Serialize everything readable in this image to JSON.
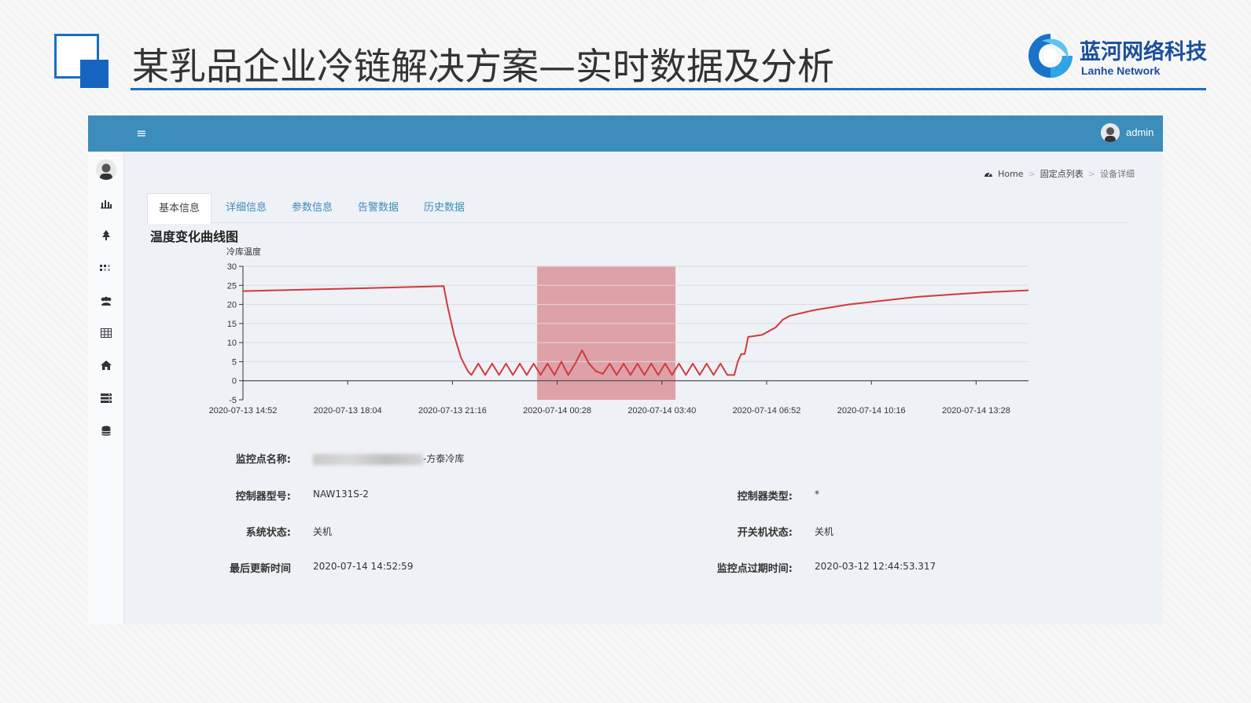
{
  "slide": {
    "title": "某乳品企业冷链解决方案—实时数据及分析",
    "logo_cn": "蓝河网络科技",
    "logo_en": "Lanhe Network",
    "accent": "#1b6ec2"
  },
  "topbar": {
    "menu_icon": "≡",
    "user": "admin",
    "color": "#3c8dbc"
  },
  "sidebar": {
    "items": [
      {
        "icon": "bar-chart-icon"
      },
      {
        "icon": "tree-icon"
      },
      {
        "icon": "grid-dots-icon"
      },
      {
        "icon": "users-icon"
      },
      {
        "icon": "table-icon"
      },
      {
        "icon": "home-icon"
      },
      {
        "icon": "server-icon"
      },
      {
        "icon": "database-icon"
      }
    ]
  },
  "breadcrumb": {
    "home": "Home",
    "list": "固定点列表",
    "current": "设备详细"
  },
  "tabs": [
    "基本信息",
    "详细信息",
    "参数信息",
    "告警数据",
    "历史数据"
  ],
  "chart_title": "温度变化曲线图",
  "chart_data": {
    "type": "line",
    "ylabel": "冷库温度",
    "ylim": [
      -5,
      30
    ],
    "yticks": [
      30,
      25,
      20,
      15,
      10,
      5,
      0,
      -5
    ],
    "xticks": [
      "2020-07-13 14:52",
      "2020-07-13 18:04",
      "2020-07-13 21:16",
      "2020-07-14 00:28",
      "2020-07-14 03:40",
      "2020-07-14 06:52",
      "2020-07-14 10:16",
      "2020-07-14 13:28"
    ],
    "x_range": [
      0,
      22.7
    ],
    "highlight": {
      "x_start": 8.5,
      "x_end": 12.5,
      "color": "#d46c74"
    },
    "line_color": "#d0393f",
    "series": [
      {
        "x": [
          0,
          3.2,
          5.8,
          5.9,
          6.1,
          6.3,
          6.5,
          6.6,
          6.8,
          7.0,
          7.2,
          7.4,
          7.6,
          7.8,
          8.0,
          8.2,
          8.4,
          8.6,
          8.8,
          9.0,
          9.2,
          9.4,
          9.6,
          9.8,
          10.0,
          10.2,
          10.4,
          10.6,
          10.8,
          11.0,
          11.2,
          11.4,
          11.6,
          11.8,
          12.0,
          12.2,
          12.4,
          12.6,
          12.8,
          13.0,
          13.2,
          13.4,
          13.6,
          13.8,
          14.0,
          14.2,
          14.3,
          14.4,
          14.5,
          14.6,
          15.0,
          15.4,
          15.6,
          15.8,
          16.5,
          17.5,
          18.5,
          19.5,
          20.5,
          21.5,
          22.7
        ],
        "y": [
          23.5,
          24.2,
          24.8,
          20.0,
          12.0,
          6.0,
          2.5,
          1.5,
          4.5,
          1.5,
          4.5,
          1.5,
          4.5,
          1.5,
          4.5,
          1.5,
          4.5,
          1.5,
          4.5,
          1.5,
          5.0,
          1.5,
          4.5,
          8.0,
          4.5,
          2.5,
          1.8,
          4.5,
          1.5,
          4.5,
          1.5,
          4.5,
          1.5,
          4.5,
          1.5,
          4.5,
          1.5,
          4.5,
          1.5,
          4.5,
          1.5,
          4.5,
          1.5,
          4.5,
          1.5,
          1.5,
          5.0,
          7.0,
          7.0,
          11.5,
          12.0,
          14.0,
          16.0,
          17.0,
          18.5,
          20.0,
          21.0,
          22.0,
          22.6,
          23.2,
          23.7
        ]
      }
    ]
  },
  "info": {
    "monitor_name_label": "监控点名称:",
    "monitor_name_suffix": "-方泰冷库",
    "controller_model_label": "控制器型号:",
    "controller_model_value": "NAW131S-2",
    "controller_type_label": "控制器类型:",
    "controller_type_value": "*",
    "system_status_label": "系统状态:",
    "system_status_value": "关机",
    "power_status_label": "开关机状态:",
    "power_status_value": "关机",
    "last_update_label": "最后更新时间",
    "last_update_value": "2020-07-14 14:52:59",
    "expire_label": "监控点过期时间:",
    "expire_value": "2020-03-12 12:44:53.317"
  }
}
